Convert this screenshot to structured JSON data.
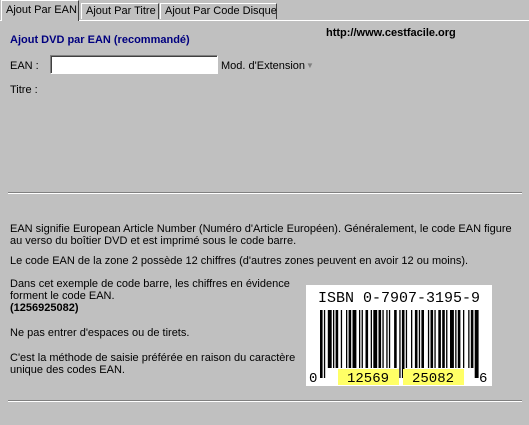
{
  "tabs": [
    {
      "label": "Ajout Par EAN",
      "active": true
    },
    {
      "label": "Ajout Par Titre",
      "active": false
    },
    {
      "label": "Ajout Par Code Disque",
      "active": false
    }
  ],
  "form": {
    "heading": "Ajout DVD par EAN (recommandé)",
    "url": "http://www.cestfacile.org",
    "ean_label": "EAN :",
    "ean_value": "",
    "extension_label": "Mod. d'Extension",
    "titre_label": "Titre :"
  },
  "info": {
    "p1": "EAN signifie European Article Number (Numéro d'Article Européen). Généralement, le code EAN figure au verso du boîtier DVD et est imprimé sous le code barre.",
    "p2": "Le code EAN de la zone 2 possède 12 chiffres (d'autres zones peuvent en avoir 12 ou moins).",
    "p3": "Dans cet exemple de code barre, les chiffres en évidence forment le code EAN.",
    "p3_code": "(1256925082)",
    "p4": "Ne pas entrer d'espaces ou de tirets.",
    "p5": "C'est la méthode de saisie préférée en raison du caractère unique des codes EAN."
  },
  "barcode": {
    "isbn": "ISBN 0-7907-3195-9",
    "left_digit": "0",
    "group1": "12569",
    "group2": "25082",
    "right_digit": "6",
    "highlight_color": "#ffff66"
  }
}
